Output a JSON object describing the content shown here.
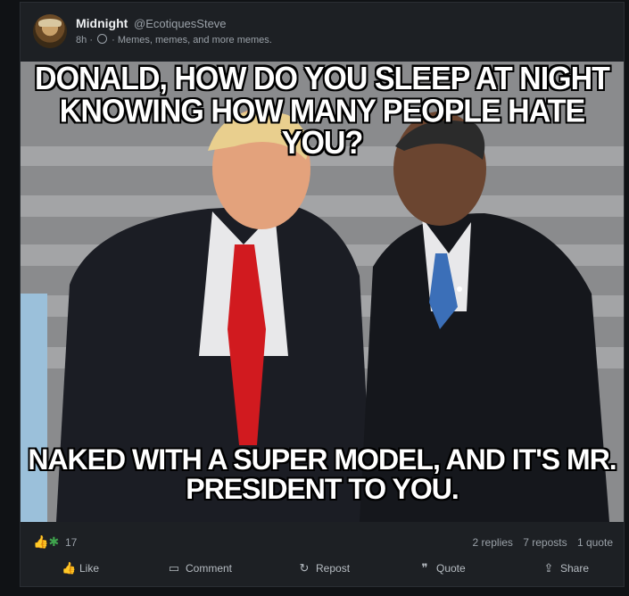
{
  "post": {
    "author": "Midnight",
    "handle": "@EcotiquesSteve",
    "time": "8h",
    "sep": "·",
    "community": "Memes, memes, and more memes.",
    "meme_top": "DONALD, HOW DO YOU SLEEP AT NIGHT KNOWING HOW MANY PEOPLE HATE YOU?",
    "meme_bottom": "NAKED WITH A SUPER MODEL, AND IT'S MR. PRESIDENT TO YOU."
  },
  "stats": {
    "reaction_count": "17",
    "replies": "2 replies",
    "reposts": "7 reposts",
    "quotes": "1 quote"
  },
  "actions": {
    "like": "Like",
    "comment": "Comment",
    "repost": "Repost",
    "quote": "Quote",
    "share": "Share"
  },
  "icons": {
    "reactions": [
      "thumbs-up-icon",
      "cactus-icon"
    ],
    "visibility": "globe-icon"
  }
}
